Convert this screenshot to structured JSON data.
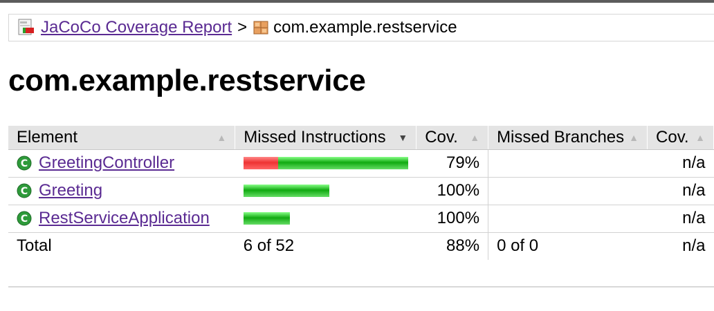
{
  "breadcrumb": {
    "root_label": "JaCoCo Coverage Report",
    "separator": ">",
    "current": "com.example.restservice"
  },
  "page_title": "com.example.restservice",
  "table": {
    "headers": {
      "element": "Element",
      "missed_instructions": "Missed Instructions",
      "cov_instructions": "Cov.",
      "missed_branches": "Missed Branches",
      "cov_branches": "Cov."
    },
    "rows": [
      {
        "name": "GreetingController",
        "instr_cov": "79%",
        "branch_cov": "n/a",
        "missed_fraction": 0.21,
        "bar_scale": 1.0
      },
      {
        "name": "Greeting",
        "instr_cov": "100%",
        "branch_cov": "n/a",
        "missed_fraction": 0.0,
        "bar_scale": 0.52
      },
      {
        "name": "RestServiceApplication",
        "instr_cov": "100%",
        "branch_cov": "n/a",
        "missed_fraction": 0.0,
        "bar_scale": 0.28
      }
    ],
    "total": {
      "label": "Total",
      "missed_instructions": "6 of 52",
      "instr_cov": "88%",
      "missed_branches": "0 of 0",
      "branch_cov": "n/a"
    }
  },
  "colors": {
    "link": "#5a2a92",
    "header_bg": "#e4e4e4",
    "bar_red": "#ee3333",
    "bar_green": "#22aa22"
  },
  "icons": {
    "report": "report-icon",
    "package": "package-icon",
    "class": "class-icon",
    "sort": "sort-arrows-icon"
  }
}
